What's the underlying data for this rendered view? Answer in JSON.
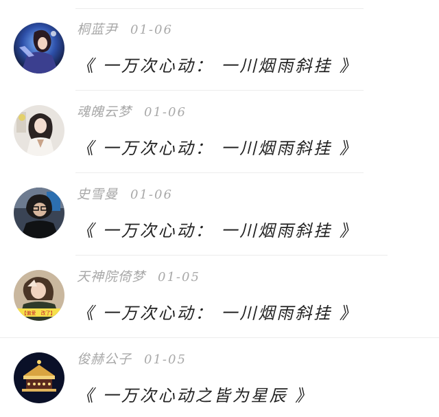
{
  "comments": [
    {
      "username": "桐蓝尹",
      "date": "01-06",
      "text": "《 一万次心动： 一川烟雨斜挂 》",
      "avatar": "fantasy-warrior-avatar"
    },
    {
      "username": "魂魄云梦",
      "date": "01-06",
      "text": "《 一万次心动： 一川烟雨斜挂 》",
      "avatar": "anime-character-avatar"
    },
    {
      "username": "史雪曼",
      "date": "01-06",
      "text": "《 一万次心动： 一川烟雨斜挂 》",
      "avatar": "person-photo-avatar"
    },
    {
      "username": "天神院倚梦",
      "date": "01-05",
      "text": "《 一万次心动： 一川烟雨斜挂 》",
      "avatar": "girl-selfie-avatar"
    },
    {
      "username": "俊赫公子",
      "date": "01-05",
      "text": "《 一万次心动之皆为星辰 》",
      "avatar": "carousel-avatar"
    }
  ],
  "avatar_badge_text": "【偏爱　改了】",
  "colors": {
    "username": "#a8a8a8",
    "text": "#222222",
    "divider": "#ececec",
    "background": "#ffffff"
  }
}
